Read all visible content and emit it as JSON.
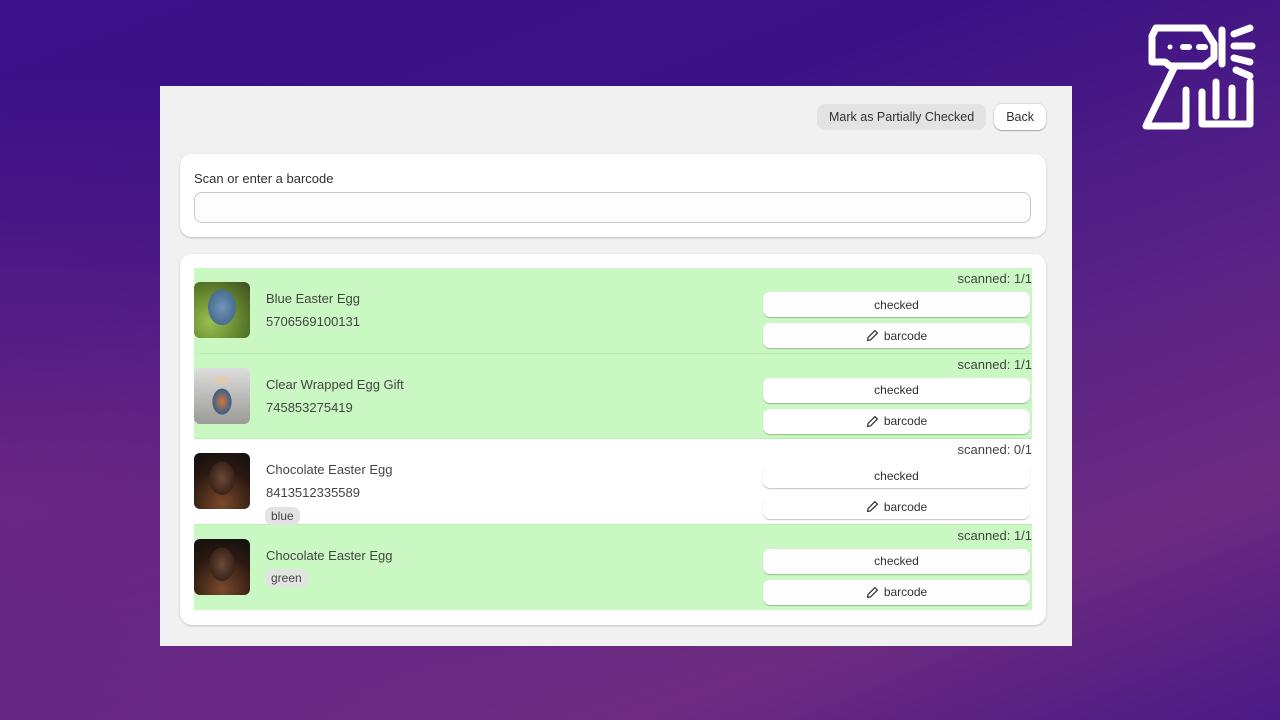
{
  "header": {
    "mark_partial_label": "Mark as Partially Checked",
    "back_label": "Back"
  },
  "scan": {
    "label": "Scan or enter a barcode",
    "value": "",
    "placeholder": ""
  },
  "colors": {
    "scanned_row": "#caf8c2",
    "background": "#3b1088"
  },
  "items": [
    {
      "name": "Blue Easter Egg",
      "barcode": "5706569100131",
      "tag": "",
      "scanned": "scanned: 1/1",
      "complete": true,
      "checked_label": "checked",
      "barcode_label": "barcode",
      "thumb": "blue-egg-on-moss"
    },
    {
      "name": "Clear Wrapped Egg Gift",
      "barcode": "745853275419",
      "tag": "",
      "scanned": "scanned: 1/1",
      "complete": true,
      "checked_label": "checked",
      "barcode_label": "barcode",
      "thumb": "wrapped-painted-egg"
    },
    {
      "name": "Chocolate Easter Egg",
      "barcode": "8413512335589",
      "tag": "blue",
      "scanned": "scanned: 0/1",
      "complete": false,
      "checked_label": "checked",
      "barcode_label": "barcode",
      "thumb": "chocolate-egg"
    },
    {
      "name": "Chocolate Easter Egg",
      "barcode": "",
      "tag": "green",
      "scanned": "scanned: 1/1",
      "complete": true,
      "checked_label": "checked",
      "barcode_label": "barcode",
      "thumb": "chocolate-egg"
    }
  ]
}
